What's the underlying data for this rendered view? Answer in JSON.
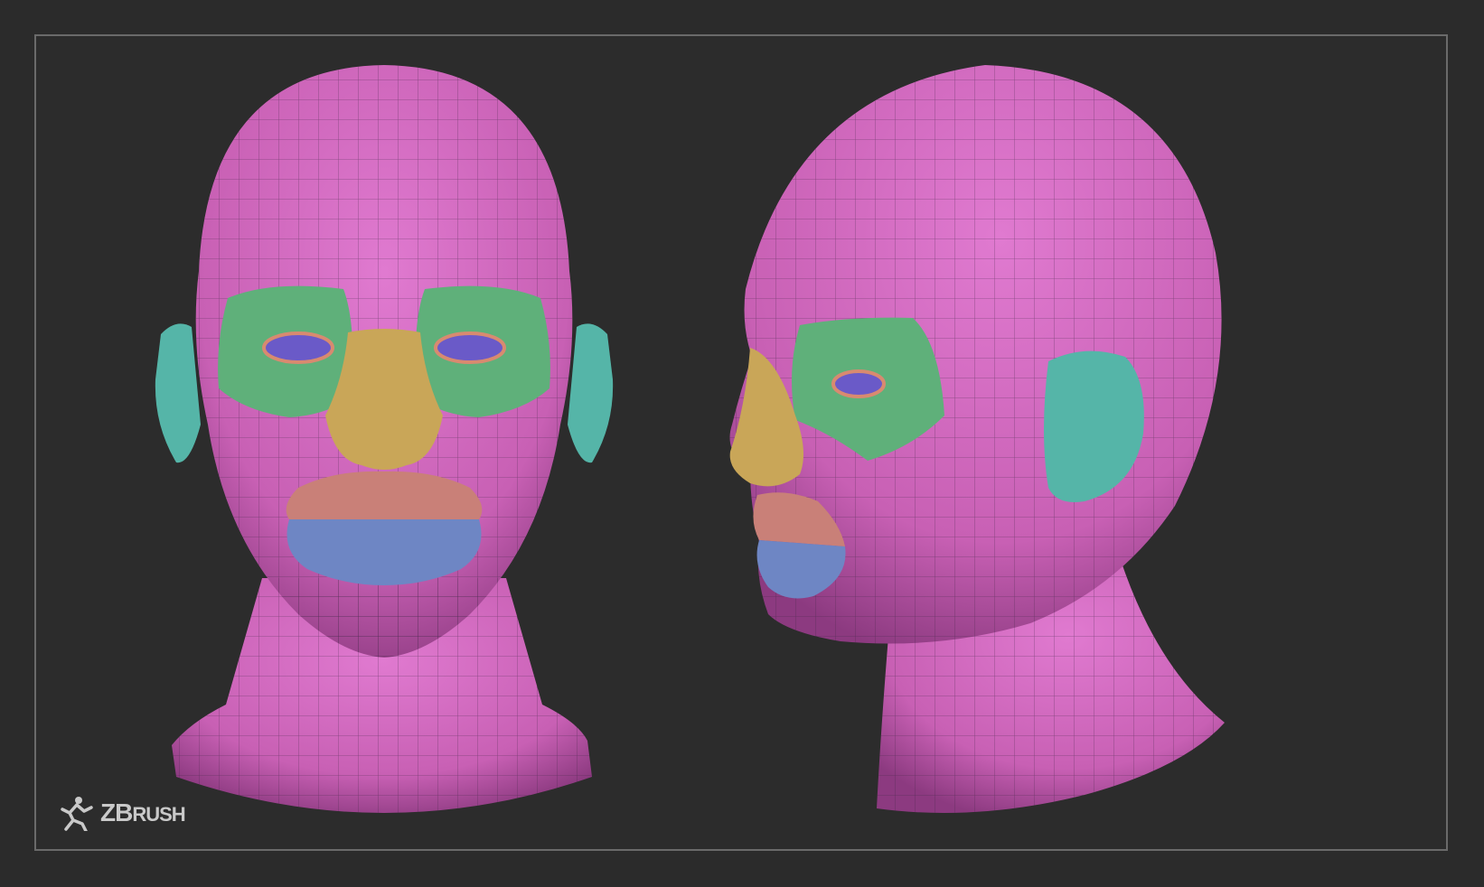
{
  "brand": {
    "name_big": "ZB",
    "name_small": "RUSH",
    "logo_icon": "running-figure-icon"
  },
  "colors": {
    "background": "#2b2b2b",
    "frame_border": "#6a6a6a",
    "skin_pink": "#c860b4",
    "eye_region_green": "#5fb07a",
    "nose_yellow": "#c9a658",
    "ear_teal": "#55b5a8",
    "upper_lip_salmon": "#c98078",
    "lower_lip_blue": "#6e86c4",
    "eyeball_purple": "#6a5ac8"
  },
  "views": [
    "front-view",
    "three-quarter-view"
  ]
}
